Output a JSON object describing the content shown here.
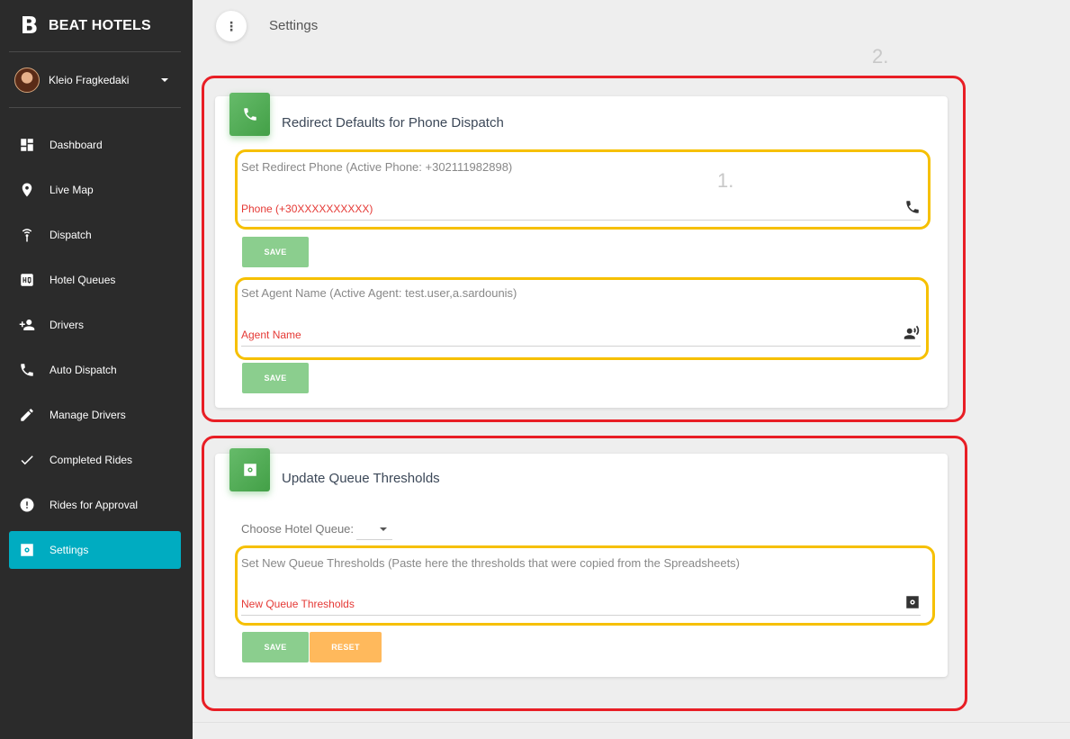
{
  "brand": {
    "logo": "B",
    "name": "BEAT HOTELS"
  },
  "user": {
    "name": "Kleio Fragkedaki"
  },
  "nav": {
    "items": [
      {
        "label": "Dashboard",
        "icon": "dashboard-icon"
      },
      {
        "label": "Live Map",
        "icon": "location-pin-icon"
      },
      {
        "label": "Dispatch",
        "icon": "dispatch-icon"
      },
      {
        "label": "Hotel Queues",
        "icon": "hq-icon"
      },
      {
        "label": "Drivers",
        "icon": "person-add-icon"
      },
      {
        "label": "Auto Dispatch",
        "icon": "phone-icon"
      },
      {
        "label": "Manage Drivers",
        "icon": "pencil-icon"
      },
      {
        "label": "Completed Rides",
        "icon": "check-icon"
      },
      {
        "label": "Rides for Approval",
        "icon": "alert-icon"
      },
      {
        "label": "Settings",
        "icon": "settings-icon",
        "active": true
      }
    ]
  },
  "header": {
    "menu": "⋮",
    "title": "Settings"
  },
  "annotations": {
    "one": "1.",
    "two": "2."
  },
  "redirect_card": {
    "title": "Redirect Defaults for Phone Dispatch",
    "phone": {
      "label": "Set Redirect Phone (Active Phone: +302111982898)",
      "placeholder": "Phone (+30XXXXXXXXXX)",
      "save": "SAVE"
    },
    "agent": {
      "label": "Set Agent Name (Active Agent: test.user,a.sardounis)",
      "placeholder": "Agent Name",
      "save": "SAVE"
    }
  },
  "queue_card": {
    "title": "Update Queue Thresholds",
    "choose_label": "Choose Hotel Queue:",
    "thresholds": {
      "label": "Set New Queue Thresholds (Paste here the thresholds that were copied from the Spreadsheets)",
      "placeholder": "New Queue Thresholds"
    },
    "save": "SAVE",
    "reset": "RESET"
  },
  "colors": {
    "sidebar": "#2b2b2b",
    "active_nav": "#00acc1",
    "card_icon": "#4caf50",
    "save_button": "#8bce8e",
    "reset_button": "#ffb95c",
    "placeholder_text": "#e53935",
    "red_outline": "#e81e25",
    "yellow_outline": "#f6c000"
  }
}
